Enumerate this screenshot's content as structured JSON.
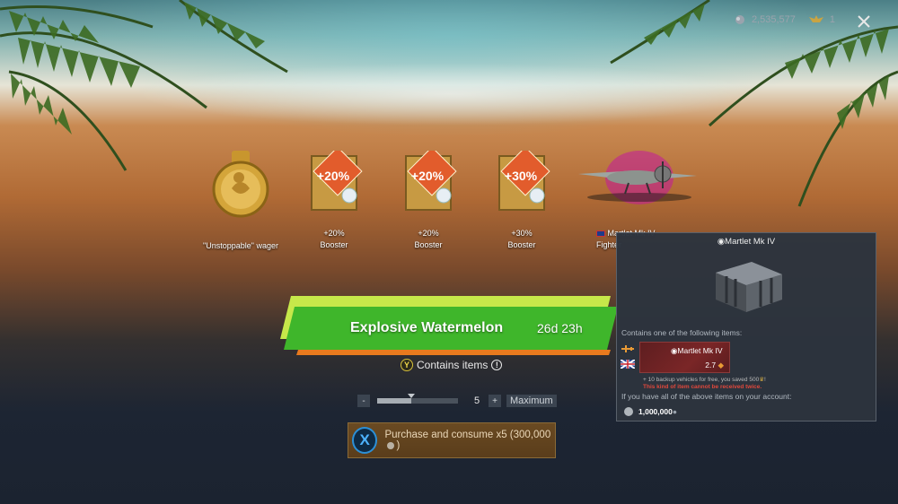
{
  "colors": {
    "banner_green": "#3fb62b",
    "banner_lime": "#c6e84a",
    "banner_orange": "#e87a1e",
    "purchase_bg": "#5a3d1b",
    "tooltip_bg": "#2c343e",
    "warning_red": "#e0483c"
  },
  "top_bar": {
    "currency_icon": "silver-lions-icon",
    "currency_value": "2,535,577",
    "warbond_icon": "golden-eagles-icon",
    "warbond_value": "1",
    "close_icon": "close-icon"
  },
  "rewards": [
    {
      "icon": "wager-medal-icon",
      "label": "\"Unstoppable\" wager"
    },
    {
      "icon": "booster-card-icon",
      "value": "+20%",
      "label": "Booster"
    },
    {
      "icon": "booster-card-icon",
      "value": "+20%",
      "label": "Booster"
    },
    {
      "icon": "booster-card-icon",
      "value": "+30%",
      "label": "Booster"
    },
    {
      "icon": "plane-icon",
      "value": "Martlet Mk IV",
      "label": "Fighter"
    }
  ],
  "banner": {
    "title": "Explosive Watermelon",
    "timer": "26d 23h"
  },
  "contains": {
    "key": "Y",
    "label": "Contains items",
    "info": "!"
  },
  "quantity": {
    "minus": "-",
    "plus": "+",
    "value": "5",
    "slider_fraction": 0.42,
    "max_label": "Maximum"
  },
  "purchase": {
    "key": "X",
    "label": "Purchase and consume x5 (300,000"
  },
  "tooltip": {
    "title": "Martlet Mk IV",
    "contains_text": "Contains one of the following items:",
    "item_name": "Martlet Mk IV",
    "item_rank": "2.7",
    "note_backup": "+ 10 backup vehicles for free, you saved 500",
    "note_warning": "This kind of item cannot be received twice.",
    "if_have": "If you have all of the above items on your account:",
    "price": "1,000,000"
  }
}
